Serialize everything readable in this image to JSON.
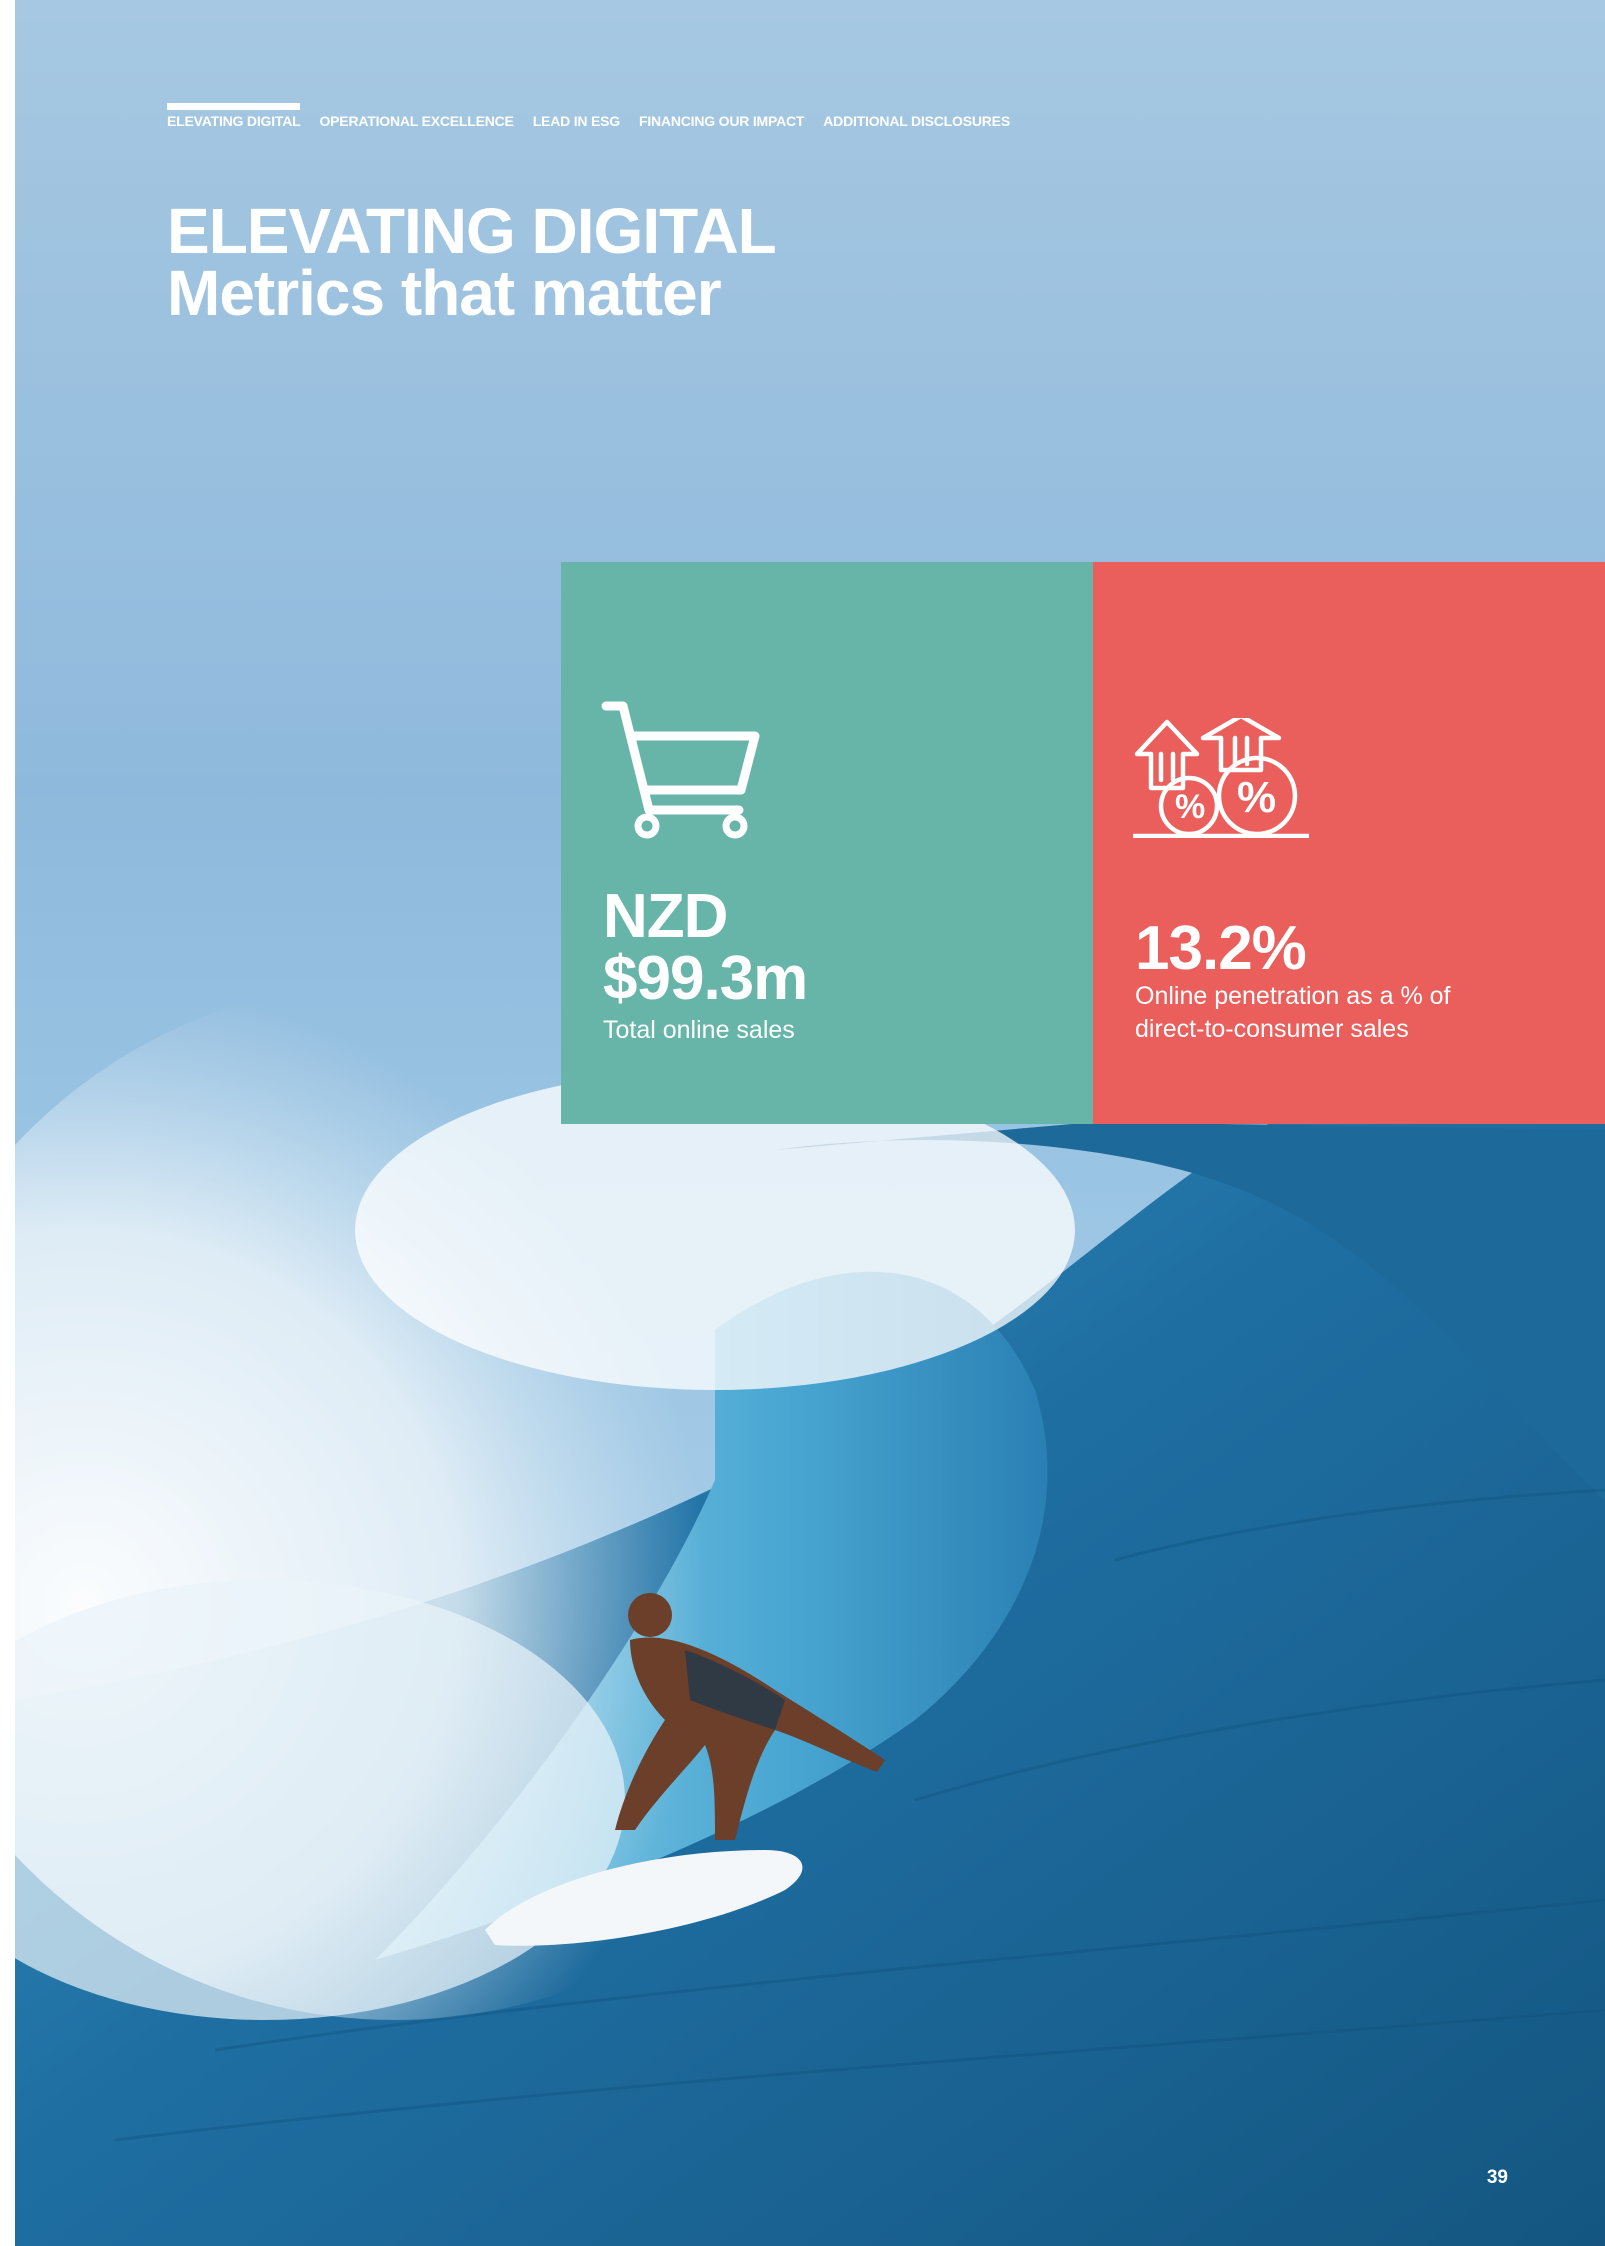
{
  "nav": {
    "items": [
      {
        "label": "ELEVATING DIGITAL",
        "active": true
      },
      {
        "label": "OPERATIONAL EXCELLENCE",
        "active": false
      },
      {
        "label": "LEAD IN ESG",
        "active": false
      },
      {
        "label": "FINANCING OUR IMPACT",
        "active": false
      },
      {
        "label": "ADDITIONAL DISCLOSURES",
        "active": false
      }
    ]
  },
  "title": {
    "line1": "ELEVATING DIGITAL",
    "line2": "Metrics that matter"
  },
  "metrics": [
    {
      "icon": "shopping-cart-icon",
      "value_line1": "NZD",
      "value_line2": "$99.3m",
      "caption": "Total online sales",
      "color": "#67b5a8"
    },
    {
      "icon": "percent-growth-icon",
      "value_line1": "13.2%",
      "caption": "Online penetration as a % of direct-to-consumer sales",
      "color": "#ea5e5b"
    }
  ],
  "page_number": "39",
  "colors": {
    "sky": "#9cc4e2",
    "ocean": "#1d6a9a",
    "text": "#ffffff"
  }
}
